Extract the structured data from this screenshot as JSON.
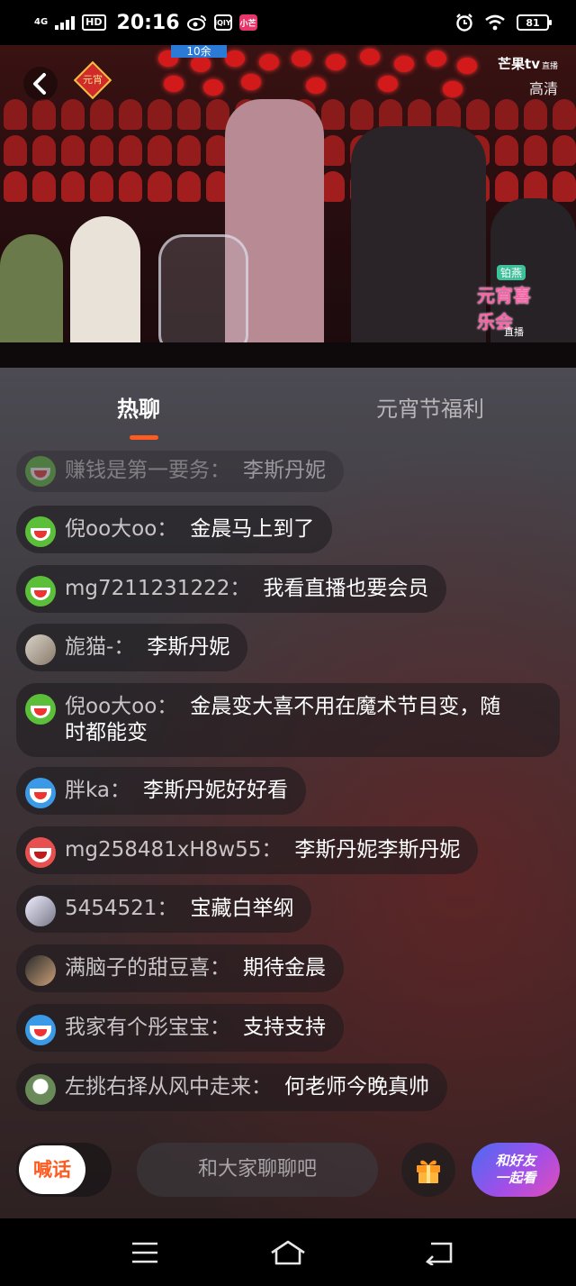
{
  "status_bar": {
    "network": "4G",
    "hd": "HD",
    "time": "20:16",
    "mini_app": "小芒",
    "battery": "81"
  },
  "video": {
    "top_tag": "10余",
    "badge": "元宵",
    "brand": "芒果tv",
    "brand_live": "直播",
    "quality": "高清",
    "show_pill": "铂燕",
    "show_name": "元宵喜乐会",
    "live_label": "直播"
  },
  "tabs": [
    {
      "label": "热聊",
      "active": true
    },
    {
      "label": "元宵节福利",
      "active": false
    }
  ],
  "messages": [
    {
      "user": "赚钱是第一要务",
      "text": "李斯丹妮"
    },
    {
      "user": "倪oo大oo",
      "text": "金晨马上到了"
    },
    {
      "user": "mg7211231222",
      "text": "我看直播也要会员"
    },
    {
      "user": "旎猫-",
      "text": "李斯丹妮"
    },
    {
      "user": "倪oo大oo",
      "text": "金晨变大喜不用在魔术节目变，随",
      "text2": "时都能变"
    },
    {
      "user": "胖ka",
      "text": "李斯丹妮好好看"
    },
    {
      "user": "mg258481xH8w55",
      "text": "李斯丹妮李斯丹妮"
    },
    {
      "user": "5454521",
      "text": "宝藏白举纲"
    },
    {
      "user": "满脑子的甜豆喜",
      "text": "期待金晨"
    },
    {
      "user": "我家有个彤宝宝",
      "text": "支持支持"
    },
    {
      "user": "左挑右择从风中走来",
      "text": "何老师今晚真帅"
    }
  ],
  "separator": "：",
  "bottom_bar": {
    "shout_label": "喊话",
    "input_placeholder": "和大家聊聊吧",
    "watch_line1": "和好友",
    "watch_line2": "一起看"
  },
  "colors": {
    "accent": "#ff5a1f",
    "watch_gradient_start": "#4a6cf2",
    "watch_gradient_end": "#e04eb8"
  },
  "icons": [
    "back-icon",
    "gift-icon",
    "menu-icon",
    "home-icon",
    "back-nav-icon",
    "alarm-icon",
    "wifi-icon",
    "signal-icon",
    "weibo-icon",
    "iqiyi-icon"
  ]
}
